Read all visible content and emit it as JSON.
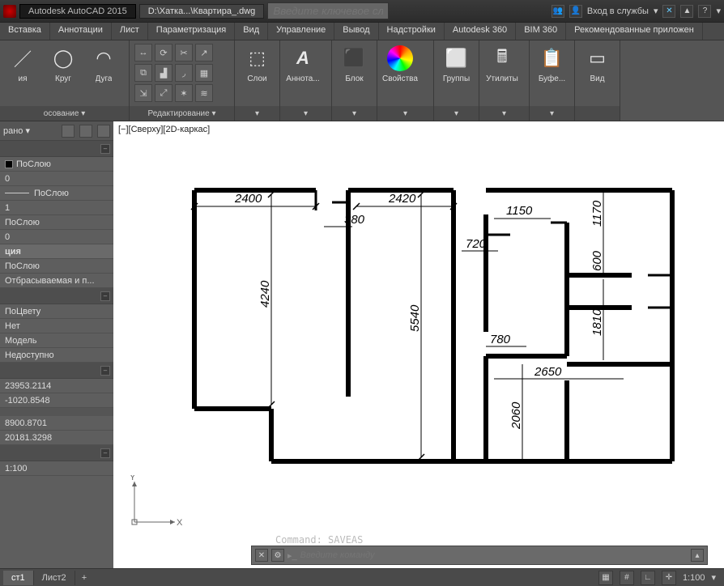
{
  "titlebar": {
    "app_title": "Autodesk AutoCAD 2015",
    "file_title": "D:\\Хатка...\\Квартира_.dwg",
    "search_placeholder": "Введите ключевое слово/фразу",
    "signin_label": "Вход в службы",
    "help_label": "?"
  },
  "menu": {
    "tabs": [
      "Вставка",
      "Аннотации",
      "Лист",
      "Параметризация",
      "Вид",
      "Управление",
      "Вывод",
      "Надстройки",
      "Autodesk 360",
      "BIM 360",
      "Рекомендованные приложен"
    ]
  },
  "ribbon": {
    "draw": {
      "label": "осование ▾",
      "btn_circle": "Круг",
      "btn_arc": "Дуга",
      "btn_line": "/"
    },
    "edit": {
      "label": "Редактирование ▾"
    },
    "layers": {
      "label": "Слои"
    },
    "annot": {
      "label": "Аннота...",
      "glyph": "A"
    },
    "block": {
      "label": "Блок"
    },
    "props": {
      "label": "Свойства"
    },
    "groups": {
      "label": "Группы"
    },
    "utils": {
      "label": "Утилиты"
    },
    "clip": {
      "label": "Буфе..."
    },
    "view": {
      "label": "Вид"
    }
  },
  "viewport": {
    "label": "[−][Сверху][2D-каркас]"
  },
  "props": {
    "selected_label": "рано ▾",
    "color_label": "ПоСлою",
    "layer_value": "0",
    "ltype_label": "ПоСлою",
    "ltscale_value": "1",
    "lweight_label": "ПоСлою",
    "transparency_value": "0",
    "section_viz": "ция",
    "material_label": "ПоСлою",
    "shadow_label": "Отбрасываемая и п...",
    "plotstyle_label": "ПоЦвету",
    "hyperlink_label": "Нет",
    "space_label": "Модель",
    "unavailable_label": "Недоступно",
    "coord_x": "23953.2114",
    "coord_y": "-1020.8548",
    "coord_w": "8900.8701",
    "coord_h": "20181.3298",
    "scale_value": "1:100"
  },
  "plan": {
    "dims": {
      "d2400": "2400",
      "d2420": "2420",
      "d380": "380",
      "d1150": "1150",
      "d1170": "1170",
      "d720": "720",
      "d600": "600",
      "d4240": "4240",
      "d5540": "5540",
      "d1810": "1810",
      "d780": "780",
      "d2650": "2650",
      "d2060": "2060"
    }
  },
  "cmd": {
    "placeholder": "Введите команду",
    "ghost": "Command:  SAVEAS"
  },
  "layout_tabs": {
    "t1": "ст1",
    "t2": "Лист2",
    "plus": "+"
  },
  "status": {
    "scale": "1:100"
  },
  "ucs": {
    "x": "X",
    "y": "Y"
  }
}
